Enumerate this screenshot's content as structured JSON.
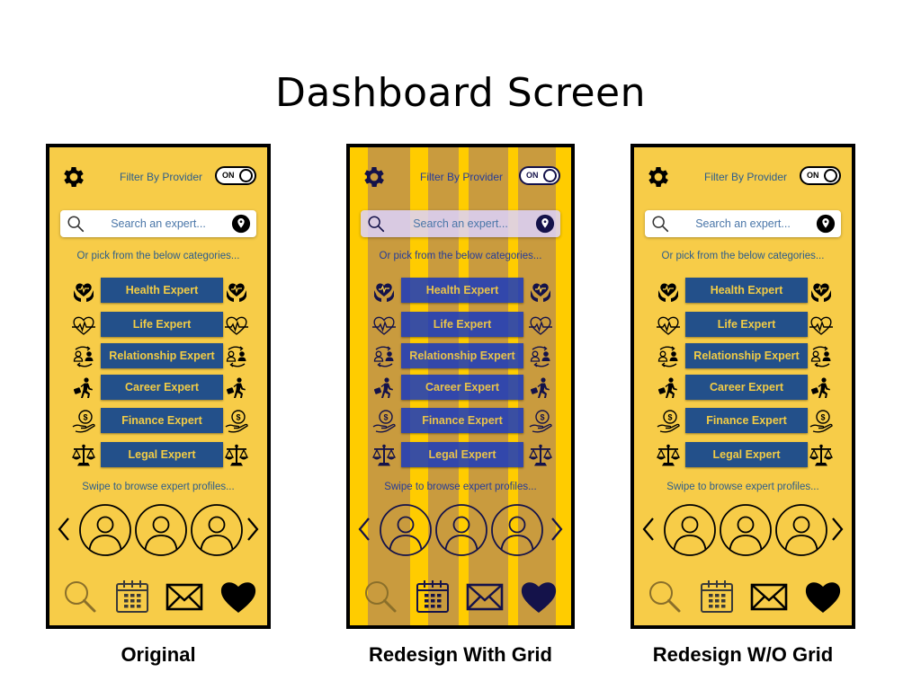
{
  "slide": {
    "title": "Dashboard Screen"
  },
  "colors": {
    "app_background": "#f7cc48",
    "category_button": "#23508a",
    "category_text": "#f2cc45",
    "label_text": "#2c5d8c",
    "grid_column": "#ffcc00",
    "grid_gutter_overlay": "#c99b3e",
    "grid_ink": "#14124a"
  },
  "screens": [
    {
      "caption": "Original",
      "show_grid": false,
      "filter_label": "Filter By Provider",
      "toggle_label": "ON",
      "search_placeholder": "Search an expert...",
      "pick_label": "Or pick from the below categories...",
      "categories": [
        {
          "label": "Health Expert",
          "icon": "health-hands-heart-icon"
        },
        {
          "label": "Life Expert",
          "icon": "heartbeat-icon"
        },
        {
          "label": "Relationship Expert",
          "icon": "relationship-exchange-icon"
        },
        {
          "label": "Career Expert",
          "icon": "career-briefcase-icon"
        },
        {
          "label": "Finance Expert",
          "icon": "finance-hand-coin-icon"
        },
        {
          "label": "Legal Expert",
          "icon": "legal-scales-icon"
        }
      ],
      "swipe_label": "Swipe to browse expert profiles...",
      "profiles_count": 3,
      "nav": [
        "search-icon",
        "calendar-icon",
        "mail-icon",
        "heart-icon"
      ]
    },
    {
      "caption": "Redesign With Grid",
      "show_grid": true,
      "filter_label": "Filter By Provider",
      "toggle_label": "ON",
      "search_placeholder": "Search an expert...",
      "pick_label": "Or pick from the below categories...",
      "categories": [
        {
          "label": "Health Expert",
          "icon": "health-hands-heart-icon"
        },
        {
          "label": "Life Expert",
          "icon": "heartbeat-icon"
        },
        {
          "label": "Relationship Expert",
          "icon": "relationship-exchange-icon"
        },
        {
          "label": "Career Expert",
          "icon": "career-briefcase-icon"
        },
        {
          "label": "Finance Expert",
          "icon": "finance-hand-coin-icon"
        },
        {
          "label": "Legal Expert",
          "icon": "legal-scales-icon"
        }
      ],
      "swipe_label": "Swipe to browse expert profiles...",
      "profiles_count": 3,
      "nav": [
        "search-icon",
        "calendar-icon",
        "mail-icon",
        "heart-icon"
      ]
    },
    {
      "caption": "Redesign W/O Grid",
      "show_grid": false,
      "filter_label": "Filter By Provider",
      "toggle_label": "ON",
      "search_placeholder": "Search an expert...",
      "pick_label": "Or pick from the below categories...",
      "categories": [
        {
          "label": "Health Expert",
          "icon": "health-hands-heart-icon"
        },
        {
          "label": "Life Expert",
          "icon": "heartbeat-icon"
        },
        {
          "label": "Relationship Expert",
          "icon": "relationship-exchange-icon"
        },
        {
          "label": "Career Expert",
          "icon": "career-briefcase-icon"
        },
        {
          "label": "Finance Expert",
          "icon": "finance-hand-coin-icon"
        },
        {
          "label": "Legal Expert",
          "icon": "legal-scales-icon"
        }
      ],
      "swipe_label": "Swipe to browse expert profiles...",
      "profiles_count": 3,
      "nav": [
        "search-icon",
        "calendar-icon",
        "mail-icon",
        "heart-icon"
      ]
    }
  ]
}
